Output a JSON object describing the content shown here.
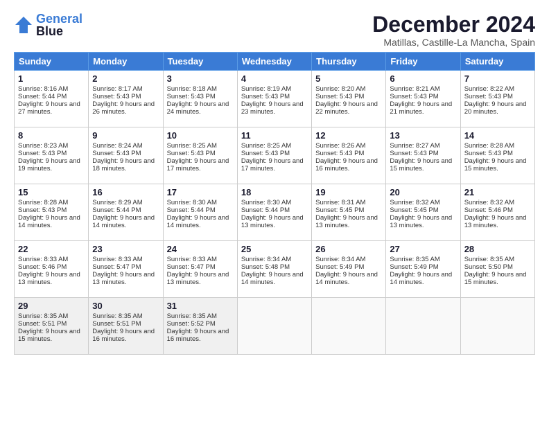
{
  "logo": {
    "text_general": "General",
    "text_blue": "Blue"
  },
  "title": "December 2024",
  "subtitle": "Matillas, Castille-La Mancha, Spain",
  "days_of_week": [
    "Sunday",
    "Monday",
    "Tuesday",
    "Wednesday",
    "Thursday",
    "Friday",
    "Saturday"
  ],
  "weeks": [
    [
      {
        "day": 1,
        "sunrise": "8:16 AM",
        "sunset": "5:44 PM",
        "daylight": "9 hours and 27 minutes."
      },
      {
        "day": 2,
        "sunrise": "8:17 AM",
        "sunset": "5:43 PM",
        "daylight": "9 hours and 26 minutes."
      },
      {
        "day": 3,
        "sunrise": "8:18 AM",
        "sunset": "5:43 PM",
        "daylight": "9 hours and 24 minutes."
      },
      {
        "day": 4,
        "sunrise": "8:19 AM",
        "sunset": "5:43 PM",
        "daylight": "9 hours and 23 minutes."
      },
      {
        "day": 5,
        "sunrise": "8:20 AM",
        "sunset": "5:43 PM",
        "daylight": "9 hours and 22 minutes."
      },
      {
        "day": 6,
        "sunrise": "8:21 AM",
        "sunset": "5:43 PM",
        "daylight": "9 hours and 21 minutes."
      },
      {
        "day": 7,
        "sunrise": "8:22 AM",
        "sunset": "5:43 PM",
        "daylight": "9 hours and 20 minutes."
      }
    ],
    [
      {
        "day": 8,
        "sunrise": "8:23 AM",
        "sunset": "5:43 PM",
        "daylight": "9 hours and 19 minutes."
      },
      {
        "day": 9,
        "sunrise": "8:24 AM",
        "sunset": "5:43 PM",
        "daylight": "9 hours and 18 minutes."
      },
      {
        "day": 10,
        "sunrise": "8:25 AM",
        "sunset": "5:43 PM",
        "daylight": "9 hours and 17 minutes."
      },
      {
        "day": 11,
        "sunrise": "8:25 AM",
        "sunset": "5:43 PM",
        "daylight": "9 hours and 17 minutes."
      },
      {
        "day": 12,
        "sunrise": "8:26 AM",
        "sunset": "5:43 PM",
        "daylight": "9 hours and 16 minutes."
      },
      {
        "day": 13,
        "sunrise": "8:27 AM",
        "sunset": "5:43 PM",
        "daylight": "9 hours and 15 minutes."
      },
      {
        "day": 14,
        "sunrise": "8:28 AM",
        "sunset": "5:43 PM",
        "daylight": "9 hours and 15 minutes."
      }
    ],
    [
      {
        "day": 15,
        "sunrise": "8:28 AM",
        "sunset": "5:43 PM",
        "daylight": "9 hours and 14 minutes."
      },
      {
        "day": 16,
        "sunrise": "8:29 AM",
        "sunset": "5:44 PM",
        "daylight": "9 hours and 14 minutes."
      },
      {
        "day": 17,
        "sunrise": "8:30 AM",
        "sunset": "5:44 PM",
        "daylight": "9 hours and 14 minutes."
      },
      {
        "day": 18,
        "sunrise": "8:30 AM",
        "sunset": "5:44 PM",
        "daylight": "9 hours and 13 minutes."
      },
      {
        "day": 19,
        "sunrise": "8:31 AM",
        "sunset": "5:45 PM",
        "daylight": "9 hours and 13 minutes."
      },
      {
        "day": 20,
        "sunrise": "8:32 AM",
        "sunset": "5:45 PM",
        "daylight": "9 hours and 13 minutes."
      },
      {
        "day": 21,
        "sunrise": "8:32 AM",
        "sunset": "5:46 PM",
        "daylight": "9 hours and 13 minutes."
      }
    ],
    [
      {
        "day": 22,
        "sunrise": "8:33 AM",
        "sunset": "5:46 PM",
        "daylight": "9 hours and 13 minutes."
      },
      {
        "day": 23,
        "sunrise": "8:33 AM",
        "sunset": "5:47 PM",
        "daylight": "9 hours and 13 minutes."
      },
      {
        "day": 24,
        "sunrise": "8:33 AM",
        "sunset": "5:47 PM",
        "daylight": "9 hours and 13 minutes."
      },
      {
        "day": 25,
        "sunrise": "8:34 AM",
        "sunset": "5:48 PM",
        "daylight": "9 hours and 14 minutes."
      },
      {
        "day": 26,
        "sunrise": "8:34 AM",
        "sunset": "5:49 PM",
        "daylight": "9 hours and 14 minutes."
      },
      {
        "day": 27,
        "sunrise": "8:35 AM",
        "sunset": "5:49 PM",
        "daylight": "9 hours and 14 minutes."
      },
      {
        "day": 28,
        "sunrise": "8:35 AM",
        "sunset": "5:50 PM",
        "daylight": "9 hours and 15 minutes."
      }
    ],
    [
      {
        "day": 29,
        "sunrise": "8:35 AM",
        "sunset": "5:51 PM",
        "daylight": "9 hours and 15 minutes."
      },
      {
        "day": 30,
        "sunrise": "8:35 AM",
        "sunset": "5:51 PM",
        "daylight": "9 hours and 16 minutes."
      },
      {
        "day": 31,
        "sunrise": "8:35 AM",
        "sunset": "5:52 PM",
        "daylight": "9 hours and 16 minutes."
      },
      null,
      null,
      null,
      null
    ]
  ]
}
